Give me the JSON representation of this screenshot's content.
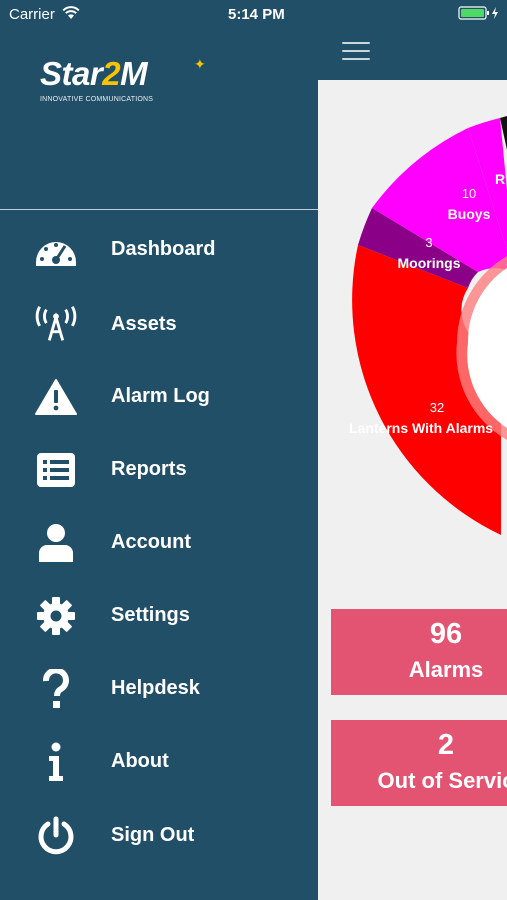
{
  "status_bar": {
    "carrier": "Carrier",
    "time": "5:14 PM"
  },
  "logo": {
    "brand_part1": "Star",
    "brand_part2": "2",
    "brand_part3": "M",
    "tagline": "INNOVATIVE COMMUNICATIONS"
  },
  "menu": {
    "items": [
      {
        "label": "Dashboard",
        "icon": "dashboard-icon"
      },
      {
        "label": "Assets",
        "icon": "antenna-icon"
      },
      {
        "label": "Alarm Log",
        "icon": "warning-icon"
      },
      {
        "label": "Reports",
        "icon": "list-icon"
      },
      {
        "label": "Account",
        "icon": "user-icon"
      },
      {
        "label": "Settings",
        "icon": "gear-icon"
      },
      {
        "label": "Helpdesk",
        "icon": "question-icon"
      },
      {
        "label": "About",
        "icon": "info-icon"
      },
      {
        "label": "Sign Out",
        "icon": "power-icon"
      }
    ]
  },
  "chart_data": {
    "type": "pie",
    "segments": [
      {
        "label": "Lanterns With Alarms",
        "value": 32,
        "color": "#ff0000"
      },
      {
        "label": "Moorings",
        "value": 3,
        "color": "#8a0087"
      },
      {
        "label": "Buoys",
        "value": 10,
        "color": "#ff00ff"
      },
      {
        "label": "R",
        "value": null,
        "color": "#ff00ff"
      }
    ]
  },
  "stats": {
    "alarms_value": "96",
    "alarms_label": "Alarms",
    "out_of_service_value": "2",
    "out_of_service_label": "Out of Servic"
  },
  "colors": {
    "sidebar_bg": "#214f67",
    "card_bg": "#e35472",
    "logo_accent": "#f6c400"
  }
}
